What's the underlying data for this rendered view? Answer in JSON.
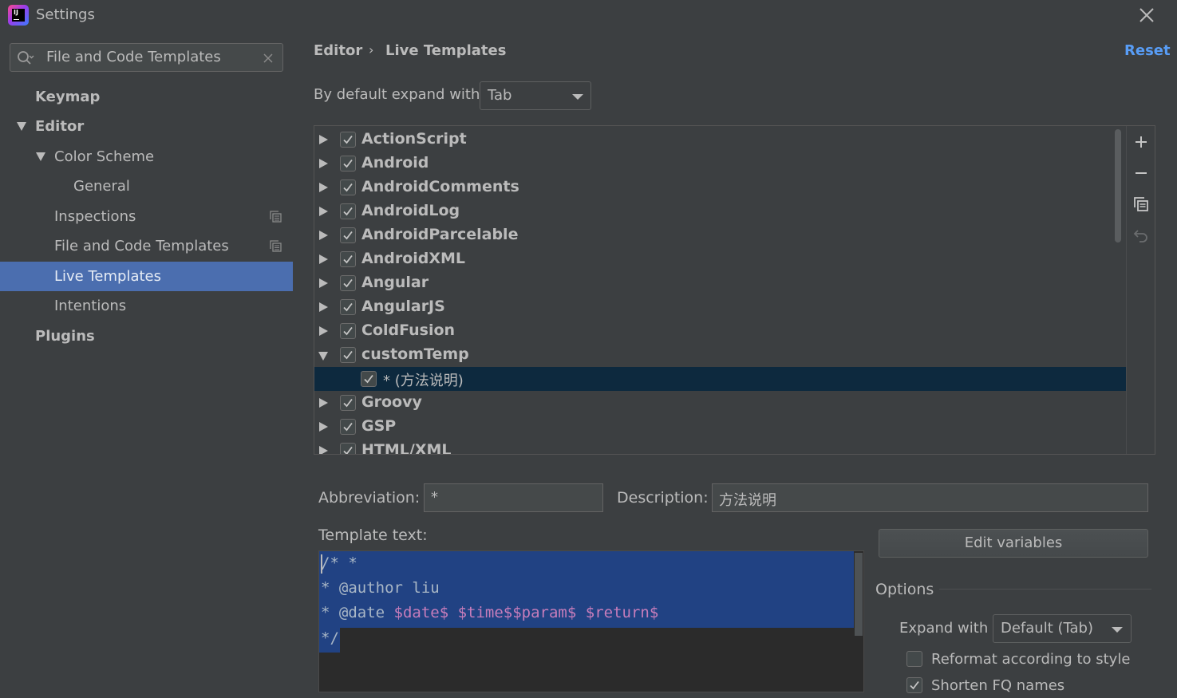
{
  "window": {
    "title": "Settings",
    "icon": "intellij-idea-icon"
  },
  "sidebar": {
    "search": {
      "value": "File and Code Templates"
    },
    "items": [
      {
        "label": "Keymap"
      },
      {
        "label": "Editor"
      },
      {
        "label": "Color Scheme"
      },
      {
        "label": "General"
      },
      {
        "label": "Inspections"
      },
      {
        "label": "File and Code Templates"
      },
      {
        "label": "Live Templates"
      },
      {
        "label": "Intentions"
      },
      {
        "label": "Plugins"
      }
    ]
  },
  "header": {
    "breadcrumb": [
      "Editor",
      "Live Templates"
    ],
    "reset_label": "Reset"
  },
  "expand": {
    "label": "By default expand with",
    "value": "Tab"
  },
  "tree": {
    "groups": [
      {
        "name": "ActionScript",
        "checked": true
      },
      {
        "name": "Android",
        "checked": true
      },
      {
        "name": "AndroidComments",
        "checked": true
      },
      {
        "name": "AndroidLog",
        "checked": true
      },
      {
        "name": "AndroidParcelable",
        "checked": true
      },
      {
        "name": "AndroidXML",
        "checked": true
      },
      {
        "name": "Angular",
        "checked": true
      },
      {
        "name": "AngularJS",
        "checked": true
      },
      {
        "name": "ColdFusion",
        "checked": true
      },
      {
        "name": "customTemp",
        "checked": true
      },
      {
        "name": "* (方法说明)",
        "checked": true
      },
      {
        "name": "Groovy",
        "checked": true
      },
      {
        "name": "GSP",
        "checked": true
      },
      {
        "name": "HTML/XML",
        "checked": true
      }
    ]
  },
  "details": {
    "abbreviation_label": "Abbreviation:",
    "abbreviation_value": "*",
    "description_label": "Description:",
    "description_value": "方法说明",
    "template_text_label": "Template text:",
    "template_lines": [
      "/* *",
      "* @author liu",
      "* @date ",
      "*/"
    ],
    "template_vars": [
      "$date$",
      " $time$$param$",
      " $return$"
    ],
    "edit_variables_label": "Edit variables"
  },
  "options": {
    "title": "Options",
    "expand_with_label": "Expand with",
    "expand_with_value": "Default (Tab)",
    "reformat_label": "Reformat according to style",
    "reformat_checked": false,
    "shorten_label": "Shorten FQ names",
    "shorten_checked": true
  },
  "colors": {
    "background": "#3c3f41",
    "selection": "#4b6eaf",
    "link": "#589df6",
    "editor_bg": "#2b2b2b",
    "editor_selection": "#214283",
    "template_variable": "#c77dbb"
  }
}
